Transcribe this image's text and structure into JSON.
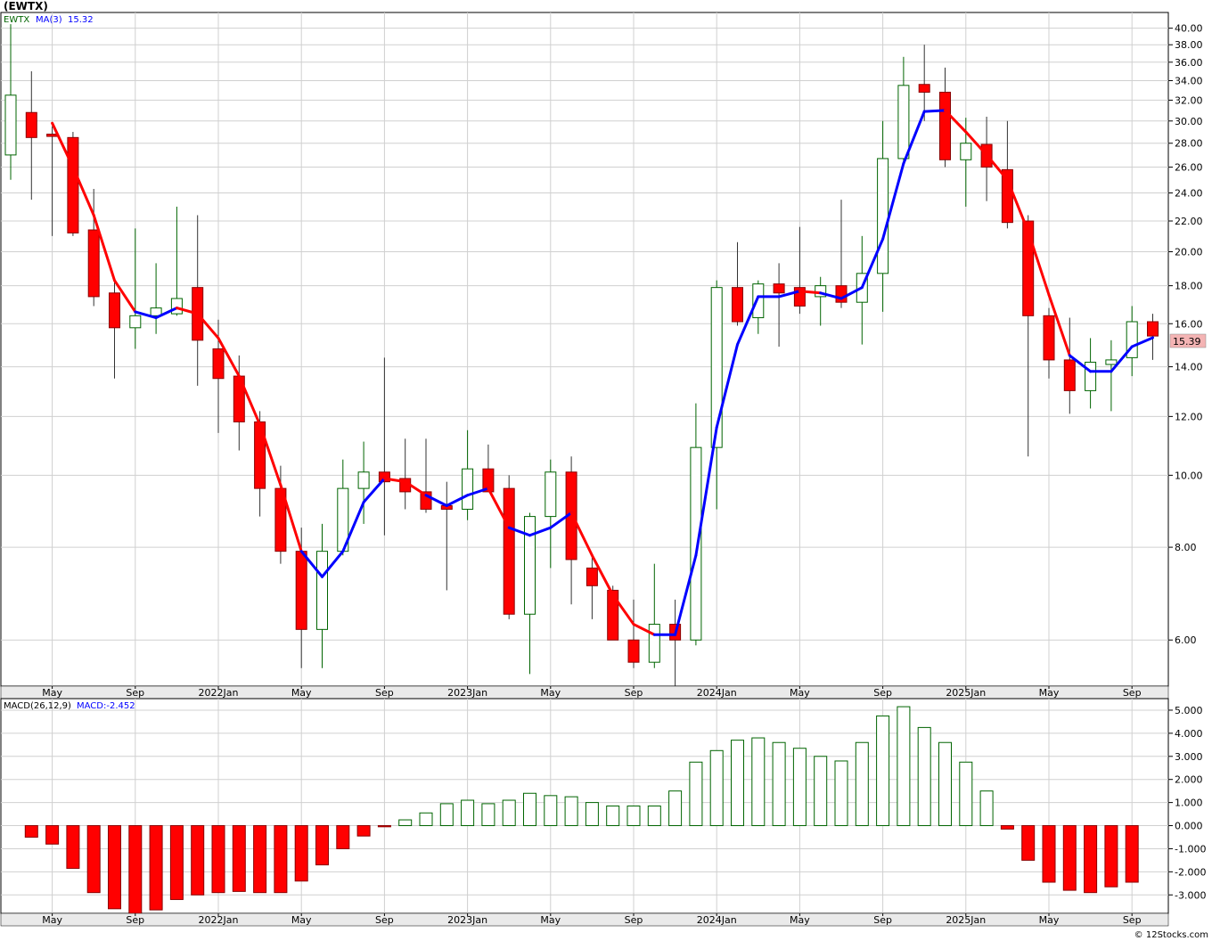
{
  "header": {
    "symbol_title": "(EWTX)",
    "legend_symbol": "EWTX",
    "legend_ma": "MA(3)",
    "legend_ma_value": "15.32",
    "last_price_tag": "15.39",
    "legend_macd": "MACD(26,12,9)",
    "legend_macd_value": "MACD:-2.452",
    "footer": "© 12Stocks.com"
  },
  "colors": {
    "up_candle_border": "#006400",
    "down_candle": "#ff0000",
    "ma_up": "#0000ff",
    "ma_down": "#ff0000",
    "macd_positive": "#006400",
    "macd_negative": "#ff0000",
    "grid": "#d0d0d0",
    "price_tag_bg": "#f4b4b4"
  },
  "chart_data": [
    {
      "type": "candlestick",
      "name": "price",
      "scale": "log",
      "ylim": [
        5.2,
        42
      ],
      "yticks": [
        "40.00",
        "38.00",
        "36.00",
        "34.00",
        "32.00",
        "30.00",
        "28.00",
        "26.00",
        "24.00",
        "22.00",
        "20.00",
        "18.00",
        "16.00",
        "14.00",
        "12.00",
        "10.00",
        "8.00",
        "6.00"
      ],
      "xticks": [
        "May",
        "Sep",
        "2022Jan",
        "May",
        "Sep",
        "2023Jan",
        "May",
        "Sep",
        "2024Jan",
        "May",
        "Sep",
        "2025Jan",
        "May",
        "Sep"
      ],
      "ohlc": [
        [
          27,
          40.5,
          25,
          32.5
        ],
        [
          30.8,
          35,
          23.5,
          28.5
        ],
        [
          28.8,
          29.5,
          21,
          28.6
        ],
        [
          28.5,
          29,
          21,
          21.2
        ],
        [
          21.4,
          24.3,
          16.9,
          17.4
        ],
        [
          17.6,
          18.3,
          13.5,
          15.8
        ],
        [
          15.8,
          21.5,
          14.8,
          16.4
        ],
        [
          16.4,
          19.3,
          15.5,
          16.8
        ],
        [
          16.5,
          23,
          16.4,
          17.3
        ],
        [
          17.9,
          22.4,
          13.2,
          15.2
        ],
        [
          14.8,
          16.2,
          11.4,
          13.5
        ],
        [
          13.6,
          14.5,
          10.8,
          11.8
        ],
        [
          11.8,
          12.2,
          8.8,
          9.6
        ],
        [
          9.6,
          10.3,
          7.6,
          7.9
        ],
        [
          7.9,
          8.5,
          5.5,
          6.2
        ],
        [
          6.2,
          8.6,
          5.5,
          7.9
        ],
        [
          7.9,
          10.5,
          7.8,
          9.6
        ],
        [
          9.6,
          11.1,
          8.6,
          10.1
        ],
        [
          10.1,
          14.4,
          8.3,
          9.8
        ],
        [
          9.9,
          11.2,
          9,
          9.5
        ],
        [
          9.5,
          11.2,
          8.9,
          9.0
        ],
        [
          9.1,
          9.8,
          7.0,
          9.0
        ],
        [
          9.0,
          11.5,
          8.7,
          10.2
        ],
        [
          10.2,
          11,
          9.5,
          9.5
        ],
        [
          9.6,
          10,
          6.4,
          6.5
        ],
        [
          6.5,
          8.9,
          5.4,
          8.8
        ],
        [
          8.8,
          10.5,
          7.5,
          10.1
        ],
        [
          10.1,
          10.6,
          6.7,
          7.7
        ],
        [
          7.5,
          7.8,
          6.4,
          7.1
        ],
        [
          7.0,
          7.1,
          6.0,
          6.0
        ],
        [
          6.0,
          6.8,
          5.5,
          5.6
        ],
        [
          5.6,
          7.6,
          5.5,
          6.3
        ],
        [
          6.3,
          6.8,
          5.1,
          6.0
        ],
        [
          6.0,
          12.5,
          5.9,
          10.9
        ],
        [
          10.9,
          18.3,
          9.0,
          17.9
        ],
        [
          17.9,
          20.6,
          15.9,
          16.1
        ],
        [
          16.3,
          18.3,
          15.5,
          18.1
        ],
        [
          18.1,
          19.3,
          14.9,
          17.6
        ],
        [
          17.9,
          21.6,
          16.5,
          16.9
        ],
        [
          17.4,
          18.5,
          15.9,
          18.0
        ],
        [
          18.0,
          23.5,
          16.8,
          17.1
        ],
        [
          17.1,
          21,
          15.0,
          18.7
        ],
        [
          18.7,
          30,
          16.6,
          26.7
        ],
        [
          26.7,
          36.6,
          26.2,
          33.5
        ],
        [
          33.6,
          38,
          30.0,
          32.8
        ],
        [
          32.8,
          35.4,
          26.0,
          26.6
        ],
        [
          26.6,
          30.3,
          23.0,
          28.0
        ],
        [
          27.9,
          30.4,
          23.4,
          26.0
        ],
        [
          25.8,
          30,
          21.5,
          21.9
        ],
        [
          22.0,
          22.4,
          10.6,
          16.4
        ],
        [
          16.4,
          16.8,
          13.5,
          14.3
        ],
        [
          14.3,
          16.3,
          12.1,
          13.0
        ],
        [
          13.0,
          15.3,
          12.3,
          14.2
        ],
        [
          14.1,
          15.2,
          12.2,
          14.3
        ],
        [
          14.4,
          16.9,
          13.6,
          16.1
        ],
        [
          16.1,
          16.5,
          14.3,
          15.4
        ]
      ],
      "ma": [
        null,
        null,
        29.8,
        26.0,
        22.4,
        18.3,
        16.6,
        16.3,
        16.8,
        16.5,
        15.3,
        13.6,
        11.7,
        9.7,
        7.9,
        7.3,
        7.9,
        9.2,
        9.9,
        9.8,
        9.4,
        9.1,
        9.4,
        9.6,
        8.5,
        8.3,
        8.5,
        8.9,
        7.8,
        6.9,
        6.3,
        6.1,
        6.1,
        7.8,
        11.6,
        15.0,
        17.4,
        17.4,
        17.7,
        17.6,
        17.3,
        17.9,
        20.8,
        26.3,
        30.9,
        31.0,
        29.0,
        27.0,
        25.0,
        21.3,
        17.5,
        14.5,
        13.8,
        13.8,
        14.9,
        15.32
      ],
      "ma_direction": [
        "",
        "",
        "down",
        "down",
        "down",
        "down",
        "down",
        "up",
        "up",
        "down",
        "down",
        "down",
        "down",
        "down",
        "down",
        "up",
        "up",
        "up",
        "up",
        "down",
        "down",
        "up",
        "up",
        "up",
        "down",
        "up",
        "up",
        "up",
        "down",
        "down",
        "down",
        "down",
        "up",
        "up",
        "up",
        "up",
        "up",
        "up",
        "up",
        "down",
        "up",
        "up",
        "up",
        "up",
        "up",
        "up",
        "down",
        "down",
        "down",
        "down",
        "down",
        "down",
        "up",
        "up",
        "up",
        "up"
      ]
    },
    {
      "type": "bar",
      "name": "MACD",
      "ylim": [
        -3.8,
        5.5
      ],
      "yticks": [
        "5.000",
        "4.000",
        "3.000",
        "2.000",
        "1.000",
        "0.000",
        "-1.000",
        "-2.000",
        "-3.000"
      ],
      "xticks": [
        "May",
        "Sep",
        "2022Jan",
        "May",
        "Sep",
        "2023Jan",
        "May",
        "Sep",
        "2024Jan",
        "May",
        "Sep",
        "2025Jan",
        "May",
        "Sep"
      ],
      "values": [
        null,
        -0.5,
        -0.8,
        -1.85,
        -2.9,
        -3.6,
        -3.85,
        -3.65,
        -3.2,
        -3.0,
        -2.9,
        -2.85,
        -2.9,
        -2.9,
        -2.4,
        -1.7,
        -1.0,
        -0.45,
        -0.05,
        0.25,
        0.55,
        0.95,
        1.1,
        0.95,
        1.1,
        1.4,
        1.3,
        1.25,
        1.0,
        0.85,
        0.85,
        0.85,
        1.5,
        2.75,
        3.25,
        3.7,
        3.8,
        3.6,
        3.35,
        3.0,
        2.8,
        3.6,
        4.75,
        5.15,
        4.25,
        3.6,
        2.75,
        1.5,
        -0.15,
        -1.5,
        -2.45,
        -2.8,
        -2.9,
        -2.65,
        -2.45
      ]
    }
  ]
}
